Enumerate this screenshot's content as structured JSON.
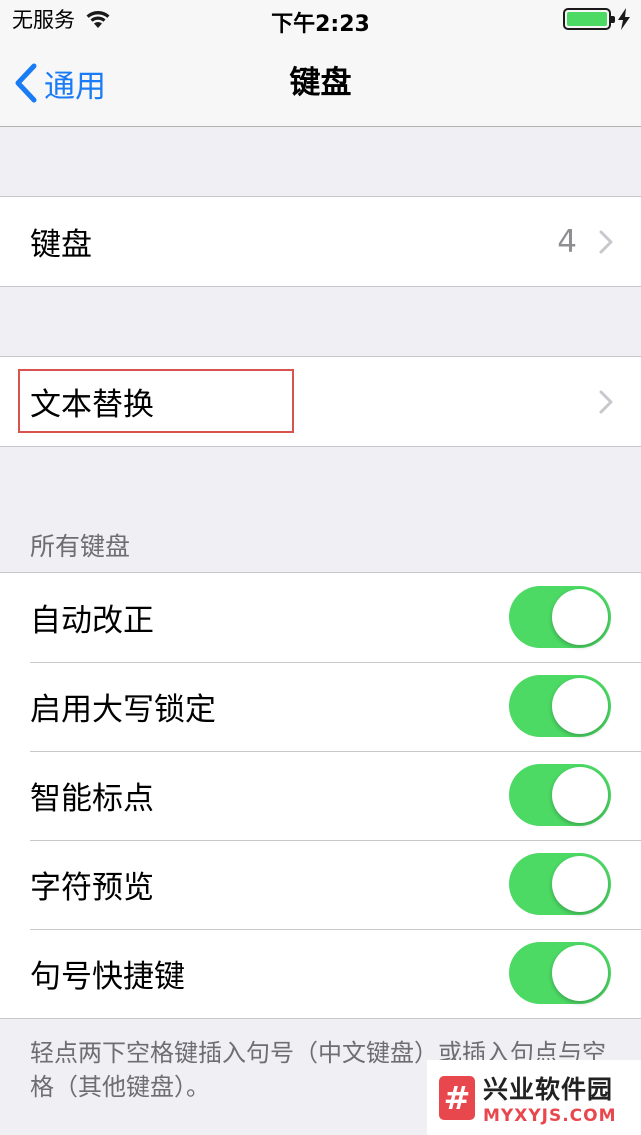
{
  "status_bar": {
    "carrier": "无服务",
    "time": "下午2:23",
    "battery_level": 1.0,
    "wifi_icon": "wifi-icon",
    "charging_icon": "charging-bolt-icon"
  },
  "nav": {
    "back_label": "通用",
    "title": "键盘"
  },
  "keyboards_row": {
    "label": "键盘",
    "value": "4"
  },
  "text_replacement_row": {
    "label": "文本替换"
  },
  "all_keyboards": {
    "header": "所有键盘",
    "items": [
      {
        "label": "自动改正",
        "on": true
      },
      {
        "label": "启用大写锁定",
        "on": true
      },
      {
        "label": "智能标点",
        "on": true
      },
      {
        "label": "字符预览",
        "on": true
      },
      {
        "label": "句号快捷键",
        "on": true
      }
    ],
    "footer": "轻点两下空格键插入句号（中文键盘）或插入句点与空格（其他键盘）。"
  },
  "watermark": {
    "logo_glyph": "#",
    "name": "兴业软件园",
    "site": "MYXYJS.COM"
  },
  "colors": {
    "accent": "#1a7cf4",
    "toggle_on": "#4cd964",
    "highlight": "#d9534f",
    "background": "#efeff4"
  }
}
